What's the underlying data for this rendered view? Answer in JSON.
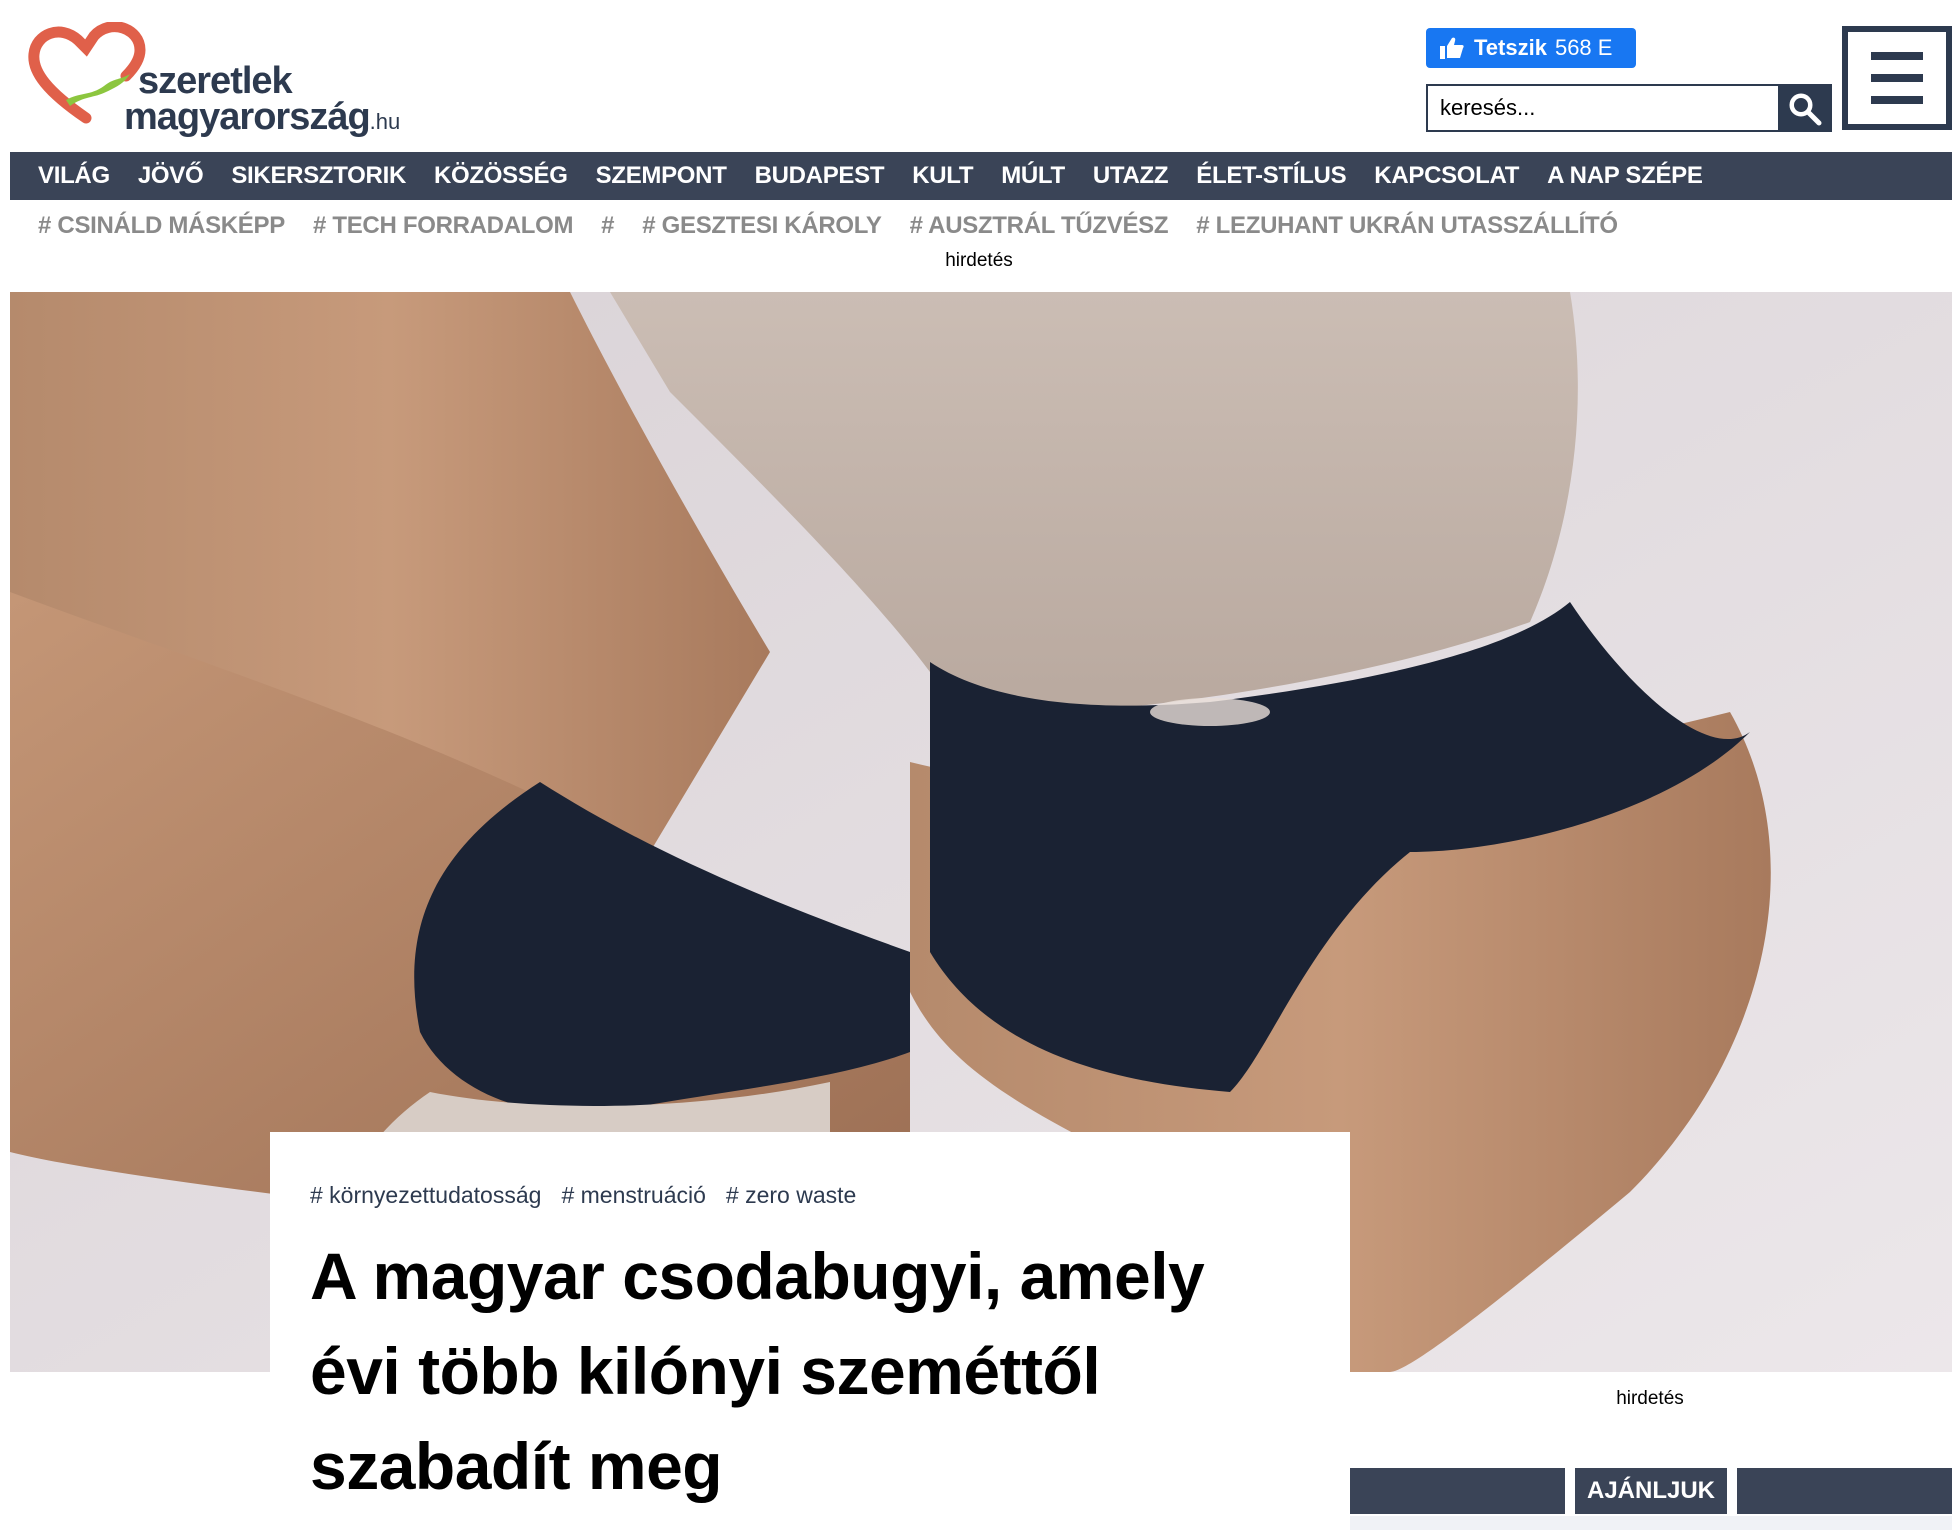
{
  "site": {
    "logo_line1": "szeretlek",
    "logo_line2": "magyarország",
    "logo_suffix": ".hu",
    "logo_icon": "heart-logo-icon"
  },
  "header": {
    "fb_like_label": "Tetszik",
    "fb_like_count": "568 E",
    "search_placeholder": "keresés...",
    "search_icon": "search-icon",
    "menu_icon": "hamburger-menu-icon"
  },
  "nav": {
    "items": [
      "VILÁG",
      "JÖVŐ",
      "SIKERSZTORIK",
      "KÖZÖSSÉG",
      "SZEMPONT",
      "BUDAPEST",
      "KULT",
      "MÚLT",
      "UTAZZ",
      "ÉLET-STÍLUS",
      "KAPCSOLAT",
      "A NAP SZÉPE"
    ]
  },
  "tags_nav": {
    "items": [
      "# CSINÁLD MÁSKÉPP",
      "# TECH FORRADALOM",
      "#",
      "# GESZTESI KÁROLY",
      "# AUSZTRÁL TŰZVÉSZ",
      "# LEZUHANT UKRÁN UTASSZÁLLÍTÓ"
    ]
  },
  "ads": {
    "top_label": "hirdetés",
    "side_label": "hirdetés"
  },
  "article": {
    "tags": [
      "# környezettudatosság",
      "# menstruáció",
      "# zero waste"
    ],
    "title_lines": [
      "A magyar csodabugyi, amely",
      "évi több kilónyi szeméttől",
      "szabadít meg"
    ]
  },
  "sidebar": {
    "recommend_label": "AJÁNLJUK"
  },
  "colors": {
    "brand_dark": "#3a4457",
    "logo_heart": "#e0604a",
    "logo_green": "#8cc63f",
    "facebook": "#1877f2"
  }
}
